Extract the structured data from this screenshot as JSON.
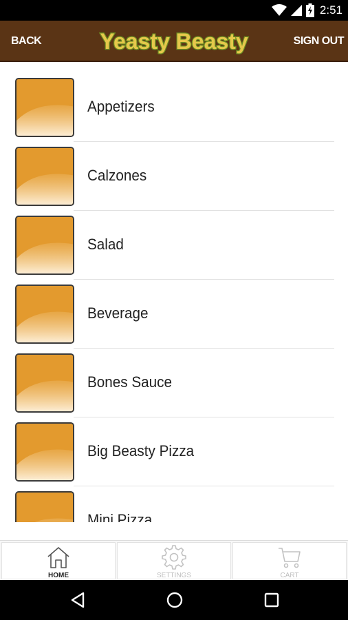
{
  "status_bar": {
    "time": "2:51",
    "icons": [
      "wifi-icon",
      "signal-icon",
      "battery-charging-icon"
    ]
  },
  "header": {
    "back_label": "BACK",
    "logo_text": "Yeasty Beasty",
    "signout_label": "SIGN OUT",
    "colors": {
      "background": "#5a3415",
      "logo_fill": "#e6c84b",
      "logo_outline": "#6b8e23"
    }
  },
  "menu": {
    "items": [
      {
        "label": "Appetizers"
      },
      {
        "label": "Calzones"
      },
      {
        "label": "Salad"
      },
      {
        "label": "Beverage"
      },
      {
        "label": "Bones Sauce"
      },
      {
        "label": "Big Beasty Pizza"
      },
      {
        "label": "Mini Pizza"
      }
    ],
    "thumb_color": "#e39a2e"
  },
  "tabs": [
    {
      "label": "HOME",
      "icon": "home-icon",
      "active": true
    },
    {
      "label": "SETTINGS",
      "icon": "gear-icon",
      "active": false
    },
    {
      "label": "CART",
      "icon": "cart-icon",
      "active": false
    }
  ],
  "nav_bar": {
    "icons": [
      "back-triangle-icon",
      "home-circle-icon",
      "recents-square-icon"
    ]
  }
}
